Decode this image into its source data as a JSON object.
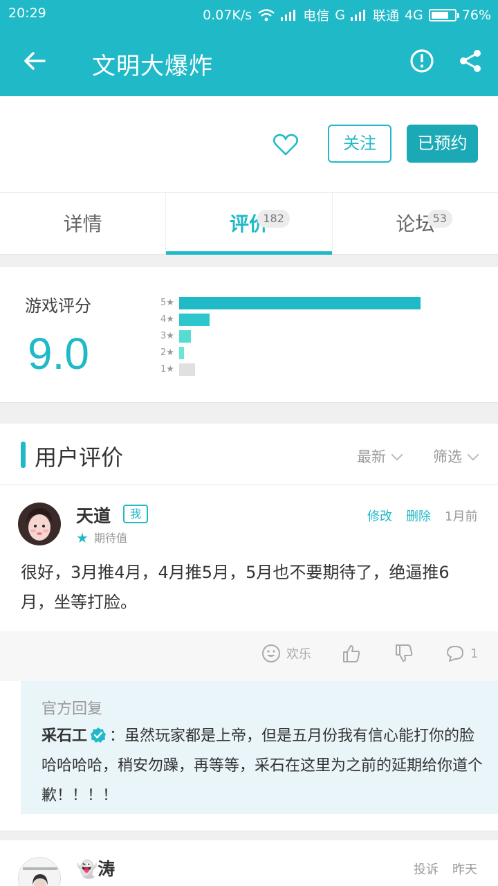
{
  "status_bar": {
    "time": "20:29",
    "speed": "0.07K/s",
    "carrier1": "电信",
    "net1": "G",
    "carrier2": "联通",
    "net2": "4G",
    "battery": "76%",
    "battery_level": 0.76
  },
  "app_bar": {
    "title": "文明大爆炸",
    "icons": [
      "back-arrow-icon",
      "report-icon",
      "share-icon"
    ]
  },
  "actions": {
    "favorite_icon": "heart-icon",
    "follow_label": "关注",
    "reserved_label": "已预约"
  },
  "tabs": [
    {
      "label": "详情",
      "badge": ""
    },
    {
      "label": "评价",
      "badge": "182"
    },
    {
      "label": "论坛",
      "badge": "53"
    }
  ],
  "rating": {
    "label": "游戏评分",
    "score": "9.0",
    "distribution": [
      {
        "stars": "5★",
        "fraction": 1.0,
        "color": "#1fb9c7"
      },
      {
        "stars": "4★",
        "fraction": 0.126,
        "color": "#2ec6cd"
      },
      {
        "stars": "3★",
        "fraction": 0.05,
        "color": "#54ddd0"
      },
      {
        "stars": "2★",
        "fraction": 0.02,
        "color": "#6ce6d4"
      },
      {
        "stars": "1★",
        "fraction": 0.066,
        "color": "#e0e0e0"
      }
    ]
  },
  "user_reviews": {
    "title": "用户评价",
    "sort": "最新",
    "filter": "筛选"
  },
  "review1": {
    "name": "天道",
    "me_tag": "我",
    "sub": "期待值",
    "edit": "修改",
    "delete": "删除",
    "time": "1月前",
    "content": "很好，3月推4月，4月推5月，5月也不要期待了，绝逼推6月，坐等打脸。",
    "happy": "欢乐",
    "comments": "1",
    "official_header": "官方回复",
    "official_author": "采石工",
    "official_text": "：虽然玩家都是上帝，但是五月份我有信心能打你的脸哈哈哈哈，稍安勿躁，再等等，采石在这里为之前的延期给你道个歉！！！！"
  },
  "review2": {
    "name": "👻涛",
    "report": "投诉",
    "time": "昨天"
  },
  "colors": {
    "accent": "#1fb9c7",
    "accent_dark": "#1ba9b6"
  }
}
